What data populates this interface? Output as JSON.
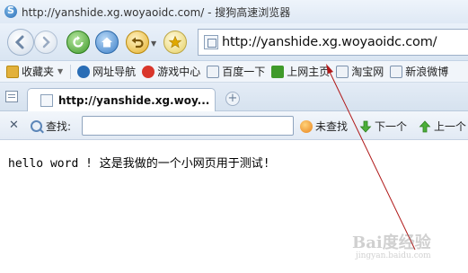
{
  "window": {
    "title": "http://yanshide.xg.woyaoidc.com/ - 搜狗高速浏览器"
  },
  "navbar": {
    "address": "http://yanshide.xg.woyaoidc.com/"
  },
  "favorites": {
    "items": [
      {
        "label": "收藏夹",
        "icon": "folder-star-icon",
        "color": "#e2b13c"
      },
      {
        "label": "网址导航",
        "icon": "sogou-icon",
        "color": "#2a6db5"
      },
      {
        "label": "游戏中心",
        "icon": "game-icon",
        "color": "#d9362b"
      },
      {
        "label": "百度一下",
        "icon": "page-icon",
        "color": "#7d93ae"
      },
      {
        "label": "上网主页",
        "icon": "hao-icon",
        "color": "#3f9a2a"
      },
      {
        "label": "淘宝网",
        "icon": "page-icon",
        "color": "#7d93ae"
      },
      {
        "label": "新浪微博",
        "icon": "page-icon",
        "color": "#7d93ae"
      }
    ]
  },
  "tabs": [
    {
      "label": "http://yanshide.xg.woy..."
    }
  ],
  "findbar": {
    "label": "查找:",
    "value": "",
    "not_found": "未查找",
    "next": "下一个",
    "prev": "上一个"
  },
  "content": {
    "text": "hello word ! 这是我做的一个小网页用于测试!"
  },
  "watermark": {
    "text": "Bai度经验",
    "sub": "jingyan.baidu.com"
  }
}
